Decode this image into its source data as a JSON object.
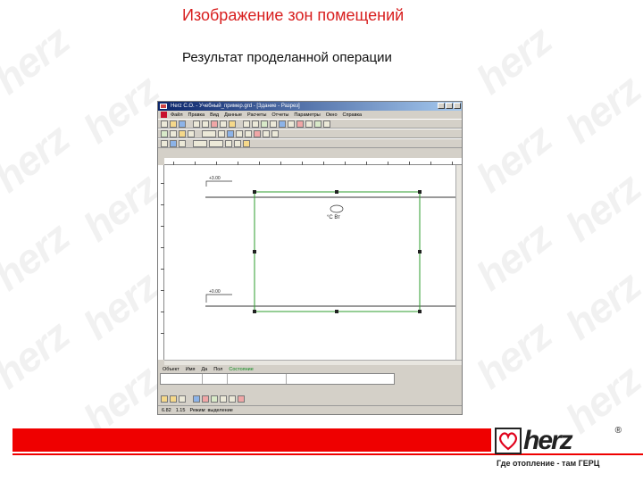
{
  "slide": {
    "title": "Изображение зон помещений",
    "subtitle": "Результат проделанной операции"
  },
  "watermark": {
    "text": "herz"
  },
  "app": {
    "window_title": "Herz C.O. - Учебный_пример.grd - [Здание - Разрез]",
    "menu": [
      "Файл",
      "Правка",
      "Вид",
      "Данные",
      "Расчеты",
      "Отчеты",
      "Параметры",
      "Окно",
      "Справка"
    ],
    "canvas": {
      "level_top": "+3.00",
      "level_bottom": "+0.00",
      "room_label": "°C  Вт"
    },
    "panel_tabs": [
      "Объект",
      "Имя",
      "Да",
      "Пол",
      "Состояние"
    ],
    "status": [
      "6.82",
      "1.15",
      "Режим: выделение"
    ]
  },
  "footer": {
    "logo_text": "herz",
    "logo_reg": "®",
    "tagline": "Где отопление - там ГЕРЦ"
  },
  "colors": {
    "accent": "#d81e1e",
    "bar": "#ef0000",
    "zone": "#2e9e2e"
  }
}
